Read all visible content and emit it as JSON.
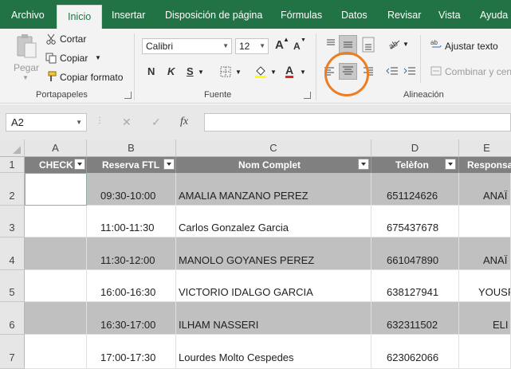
{
  "tabs": [
    "Archivo",
    "Inicio",
    "Insertar",
    "Disposición de página",
    "Fórmulas",
    "Datos",
    "Revisar",
    "Vista",
    "Ayuda"
  ],
  "active_tab": "Inicio",
  "clipboard": {
    "paste": "Pegar",
    "cut": "Cortar",
    "copy": "Copiar",
    "format_painter": "Copiar formato",
    "label": "Portapapeles"
  },
  "font": {
    "name": "Calibri",
    "size": "12",
    "bold": "N",
    "italic": "K",
    "underline": "S",
    "grow": "A",
    "shrink": "A",
    "color_letter": "A",
    "label": "Fuente"
  },
  "alignment": {
    "wrap": "Ajustar texto",
    "merge": "Combinar y cen",
    "label": "Alineación"
  },
  "formula_bar": {
    "name_box": "A2",
    "cancel": "✕",
    "enter": "✓",
    "fx": "fx",
    "value": ""
  },
  "columns": [
    "A",
    "B",
    "C",
    "D",
    "E"
  ],
  "header_row": {
    "row": "1",
    "cells": [
      "CHECK",
      "Reserva FTL",
      "Nom Complet",
      "Telèfon",
      "Responsa"
    ]
  },
  "rows": [
    {
      "row": "2",
      "time": "09:30-10:00",
      "name": "AMALIA  MANZANO PEREZ",
      "phone": "651124626",
      "resp": "ANAÏ"
    },
    {
      "row": "3",
      "time": "11:00-11:30",
      "name": "Carlos  Gonzalez Garcia",
      "phone": "675437678",
      "resp": ""
    },
    {
      "row": "4",
      "time": "11:30-12:00",
      "name": "MANOLO GOYANES PEREZ",
      "phone": "661047890",
      "resp": "ANAÏ"
    },
    {
      "row": "5",
      "time": "16:00-16:30",
      "name": "VICTORIO  IDALGO GARCIA",
      "phone": "638127941",
      "resp": "YOUSF"
    },
    {
      "row": "6",
      "time": "16:30-17:00",
      "name": "ILHAM NASSERI",
      "phone": "632311502",
      "resp": "ELI"
    },
    {
      "row": "7",
      "time": "17:00-17:30",
      "name": "Lourdes Molto  Cespedes",
      "phone": "623062066",
      "resp": ""
    }
  ],
  "colors": {
    "ribbon_green": "#217346",
    "highlight_circle": "#ee7d22",
    "header_fill": "#808080",
    "alt_row_fill": "#c0c0c0"
  }
}
